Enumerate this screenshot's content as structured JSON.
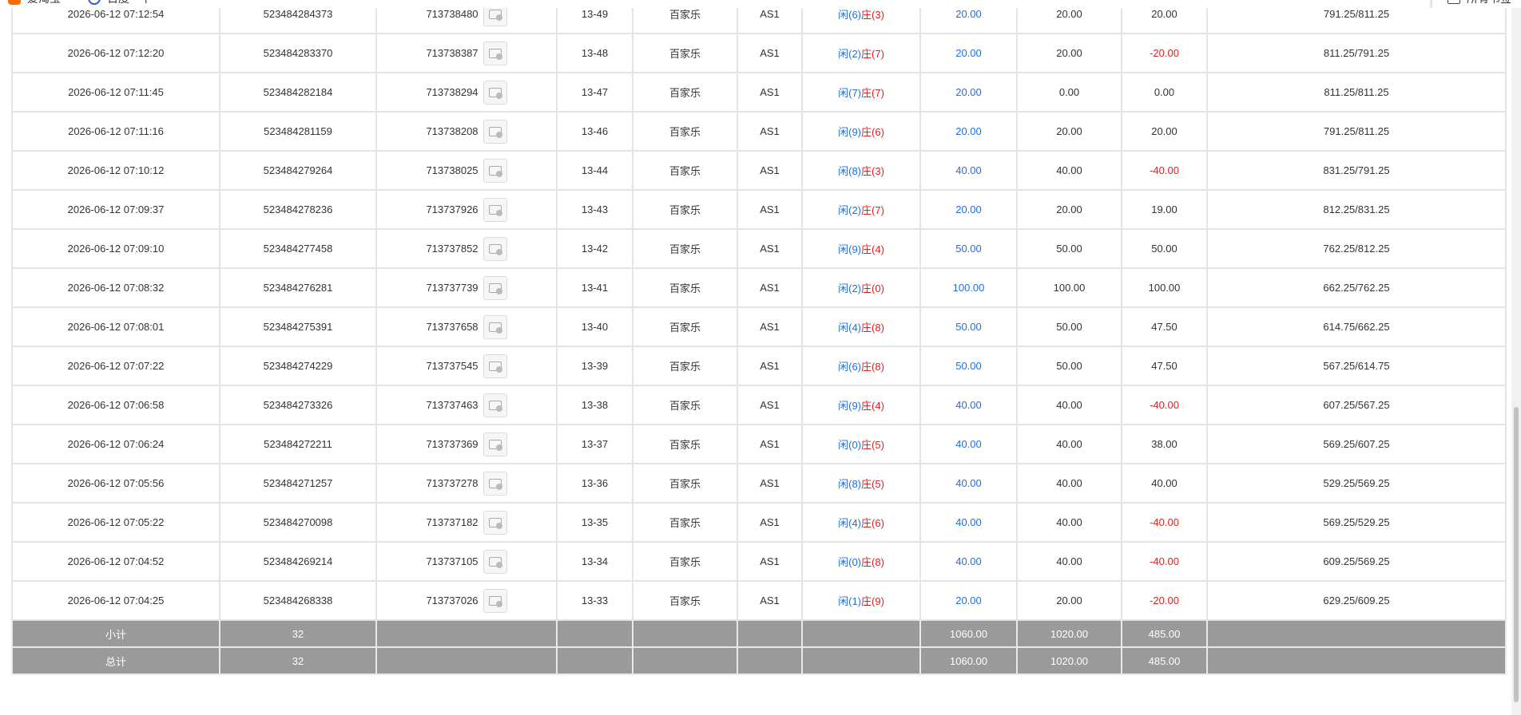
{
  "bookmarks": {
    "items": [
      {
        "label": "爱淘宝"
      },
      {
        "label": "百度一下"
      },
      {
        "label": "所有书签"
      }
    ]
  },
  "colors": {
    "positive": "#1e6fe0",
    "negative": "#e02020",
    "summary_bg": "#9a9a9a"
  },
  "rows": [
    {
      "time": "2026-06-12 07:12:54",
      "order": "523484284373",
      "game_id": "713738480",
      "round": "13-49",
      "game": "百家乐",
      "table": "AS1",
      "xian": "(6)",
      "zhuang": "(3)",
      "bet": "20.00",
      "valid": "20.00",
      "win": "20.00",
      "win_neg": false,
      "balance": "791.25/811.25"
    },
    {
      "time": "2026-06-12 07:12:20",
      "order": "523484283370",
      "game_id": "713738387",
      "round": "13-48",
      "game": "百家乐",
      "table": "AS1",
      "xian": "(2)",
      "zhuang": "(7)",
      "bet": "20.00",
      "valid": "20.00",
      "win": "-20.00",
      "win_neg": true,
      "balance": "811.25/791.25"
    },
    {
      "time": "2026-06-12 07:11:45",
      "order": "523484282184",
      "game_id": "713738294",
      "round": "13-47",
      "game": "百家乐",
      "table": "AS1",
      "xian": "(7)",
      "zhuang": "(7)",
      "bet": "20.00",
      "valid": "0.00",
      "win": "0.00",
      "win_neg": false,
      "balance": "811.25/811.25"
    },
    {
      "time": "2026-06-12 07:11:16",
      "order": "523484281159",
      "game_id": "713738208",
      "round": "13-46",
      "game": "百家乐",
      "table": "AS1",
      "xian": "(9)",
      "zhuang": "(6)",
      "bet": "20.00",
      "valid": "20.00",
      "win": "20.00",
      "win_neg": false,
      "balance": "791.25/811.25"
    },
    {
      "time": "2026-06-12 07:10:12",
      "order": "523484279264",
      "game_id": "713738025",
      "round": "13-44",
      "game": "百家乐",
      "table": "AS1",
      "xian": "(8)",
      "zhuang": "(3)",
      "bet": "40.00",
      "valid": "40.00",
      "win": "-40.00",
      "win_neg": true,
      "balance": "831.25/791.25"
    },
    {
      "time": "2026-06-12 07:09:37",
      "order": "523484278236",
      "game_id": "713737926",
      "round": "13-43",
      "game": "百家乐",
      "table": "AS1",
      "xian": "(2)",
      "zhuang": "(7)",
      "bet": "20.00",
      "valid": "20.00",
      "win": "19.00",
      "win_neg": false,
      "balance": "812.25/831.25"
    },
    {
      "time": "2026-06-12 07:09:10",
      "order": "523484277458",
      "game_id": "713737852",
      "round": "13-42",
      "game": "百家乐",
      "table": "AS1",
      "xian": "(9)",
      "zhuang": "(4)",
      "bet": "50.00",
      "valid": "50.00",
      "win": "50.00",
      "win_neg": false,
      "balance": "762.25/812.25"
    },
    {
      "time": "2026-06-12 07:08:32",
      "order": "523484276281",
      "game_id": "713737739",
      "round": "13-41",
      "game": "百家乐",
      "table": "AS1",
      "xian": "(2)",
      "zhuang": "(0)",
      "bet": "100.00",
      "valid": "100.00",
      "win": "100.00",
      "win_neg": false,
      "balance": "662.25/762.25"
    },
    {
      "time": "2026-06-12 07:08:01",
      "order": "523484275391",
      "game_id": "713737658",
      "round": "13-40",
      "game": "百家乐",
      "table": "AS1",
      "xian": "(4)",
      "zhuang": "(8)",
      "bet": "50.00",
      "valid": "50.00",
      "win": "47.50",
      "win_neg": false,
      "balance": "614.75/662.25"
    },
    {
      "time": "2026-06-12 07:07:22",
      "order": "523484274229",
      "game_id": "713737545",
      "round": "13-39",
      "game": "百家乐",
      "table": "AS1",
      "xian": "(6)",
      "zhuang": "(8)",
      "bet": "50.00",
      "valid": "50.00",
      "win": "47.50",
      "win_neg": false,
      "balance": "567.25/614.75"
    },
    {
      "time": "2026-06-12 07:06:58",
      "order": "523484273326",
      "game_id": "713737463",
      "round": "13-38",
      "game": "百家乐",
      "table": "AS1",
      "xian": "(9)",
      "zhuang": "(4)",
      "bet": "40.00",
      "valid": "40.00",
      "win": "-40.00",
      "win_neg": true,
      "balance": "607.25/567.25"
    },
    {
      "time": "2026-06-12 07:06:24",
      "order": "523484272211",
      "game_id": "713737369",
      "round": "13-37",
      "game": "百家乐",
      "table": "AS1",
      "xian": "(0)",
      "zhuang": "(5)",
      "bet": "40.00",
      "valid": "40.00",
      "win": "38.00",
      "win_neg": false,
      "balance": "569.25/607.25"
    },
    {
      "time": "2026-06-12 07:05:56",
      "order": "523484271257",
      "game_id": "713737278",
      "round": "13-36",
      "game": "百家乐",
      "table": "AS1",
      "xian": "(8)",
      "zhuang": "(5)",
      "bet": "40.00",
      "valid": "40.00",
      "win": "40.00",
      "win_neg": false,
      "balance": "529.25/569.25"
    },
    {
      "time": "2026-06-12 07:05:22",
      "order": "523484270098",
      "game_id": "713737182",
      "round": "13-35",
      "game": "百家乐",
      "table": "AS1",
      "xian": "(4)",
      "zhuang": "(6)",
      "bet": "40.00",
      "valid": "40.00",
      "win": "-40.00",
      "win_neg": true,
      "balance": "569.25/529.25"
    },
    {
      "time": "2026-06-12 07:04:52",
      "order": "523484269214",
      "game_id": "713737105",
      "round": "13-34",
      "game": "百家乐",
      "table": "AS1",
      "xian": "(0)",
      "zhuang": "(8)",
      "bet": "40.00",
      "valid": "40.00",
      "win": "-40.00",
      "win_neg": true,
      "balance": "609.25/569.25"
    },
    {
      "time": "2026-06-12 07:04:25",
      "order": "523484268338",
      "game_id": "713737026",
      "round": "13-33",
      "game": "百家乐",
      "table": "AS1",
      "xian": "(1)",
      "zhuang": "(9)",
      "bet": "20.00",
      "valid": "20.00",
      "win": "-20.00",
      "win_neg": true,
      "balance": "629.25/609.25"
    }
  ],
  "labels": {
    "xian": "闲",
    "zhuang": "庄"
  },
  "summary": [
    {
      "label": "小计",
      "count": "32",
      "bet": "1060.00",
      "valid": "1020.00",
      "win": "485.00"
    },
    {
      "label": "总计",
      "count": "32",
      "bet": "1060.00",
      "valid": "1020.00",
      "win": "485.00"
    }
  ]
}
